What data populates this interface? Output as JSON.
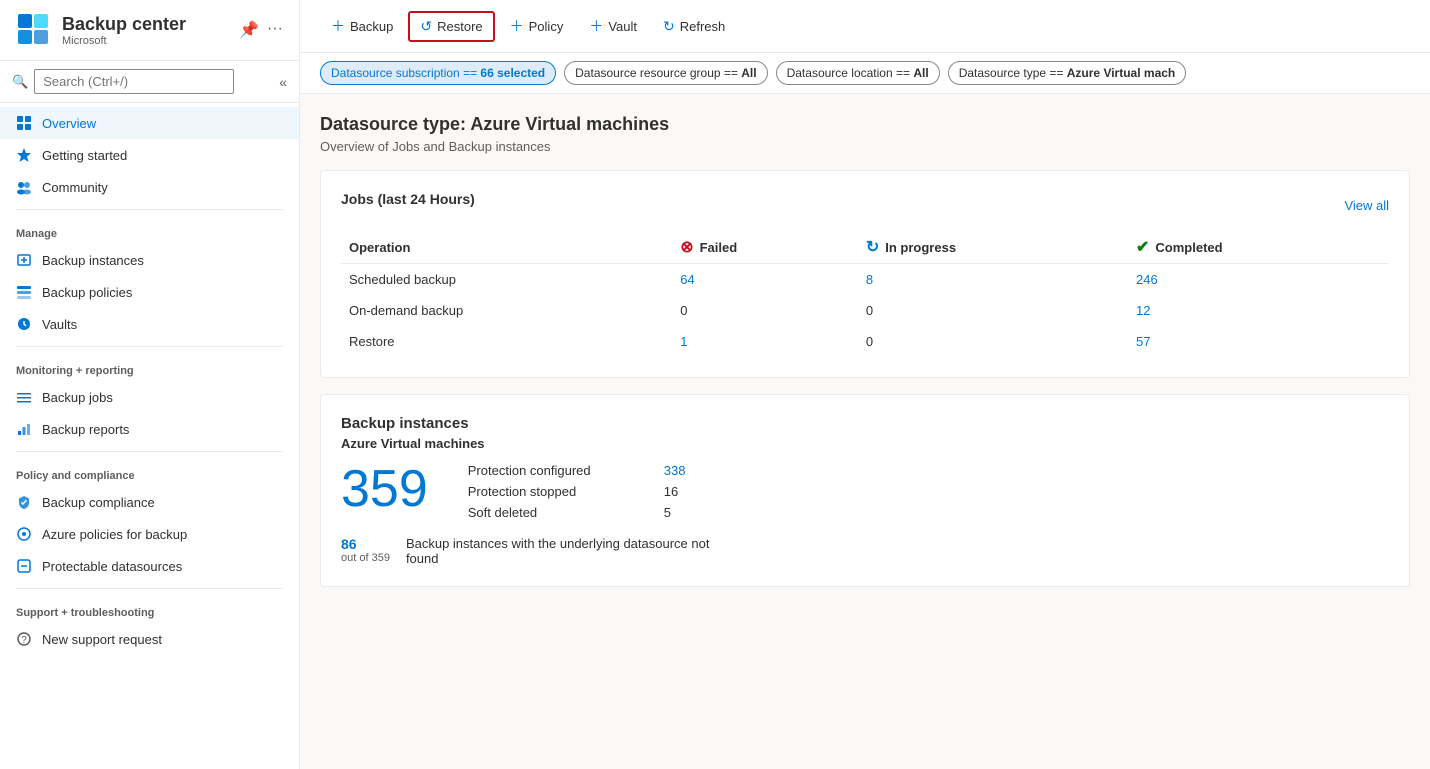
{
  "sidebar": {
    "app_title": "Backup center",
    "app_subtitle": "Microsoft",
    "search_placeholder": "Search (Ctrl+/)",
    "nav": {
      "overview": "Overview",
      "getting_started": "Getting started",
      "community": "Community",
      "manage_label": "Manage",
      "backup_instances": "Backup instances",
      "backup_policies": "Backup policies",
      "vaults": "Vaults",
      "monitoring_label": "Monitoring + reporting",
      "backup_jobs": "Backup jobs",
      "backup_reports": "Backup reports",
      "policy_label": "Policy and compliance",
      "backup_compliance": "Backup compliance",
      "azure_policies": "Azure policies for backup",
      "protectable_datasources": "Protectable datasources",
      "support_label": "Support + troubleshooting",
      "new_support": "New support request"
    }
  },
  "toolbar": {
    "backup": "Backup",
    "restore": "Restore",
    "policy": "Policy",
    "vault": "Vault",
    "refresh": "Refresh"
  },
  "filters": [
    {
      "key": "Datasource subscription",
      "op": "==",
      "value": "66 selected",
      "active": true
    },
    {
      "key": "Datasource resource group",
      "op": "==",
      "value": "All",
      "active": false
    },
    {
      "key": "Datasource location",
      "op": "==",
      "value": "All",
      "active": false
    },
    {
      "key": "Datasource type",
      "op": "==",
      "value": "Azure Virtual mach",
      "active": false
    }
  ],
  "content": {
    "title": "Datasource type: Azure Virtual machines",
    "subtitle": "Overview of Jobs and Backup instances",
    "jobs_card": {
      "title": "Jobs (last 24 Hours)",
      "view_all": "View all",
      "columns": {
        "operation": "Operation",
        "failed": "Failed",
        "in_progress": "In progress",
        "completed": "Completed"
      },
      "rows": [
        {
          "operation": "Scheduled backup",
          "failed": "64",
          "failed_link": true,
          "in_progress": "8",
          "in_progress_link": true,
          "completed": "246",
          "completed_link": true
        },
        {
          "operation": "On-demand backup",
          "failed": "0",
          "failed_link": false,
          "in_progress": "0",
          "in_progress_link": false,
          "completed": "12",
          "completed_link": true
        },
        {
          "operation": "Restore",
          "failed": "1",
          "failed_link": true,
          "in_progress": "0",
          "in_progress_link": false,
          "completed": "57",
          "completed_link": true
        }
      ]
    },
    "backup_instances_card": {
      "title": "Backup instances",
      "subtitle": "Azure Virtual machines",
      "total_count": "359",
      "details": [
        {
          "label": "Protection configured",
          "value": "338",
          "link": true
        },
        {
          "label": "Protection stopped",
          "value": "16",
          "link": false
        },
        {
          "label": "Soft deleted",
          "value": "5",
          "link": false
        }
      ],
      "bottom_count": "86",
      "bottom_count_sub": "out of 359",
      "bottom_desc": "Backup instances with the underlying datasource not found"
    }
  }
}
